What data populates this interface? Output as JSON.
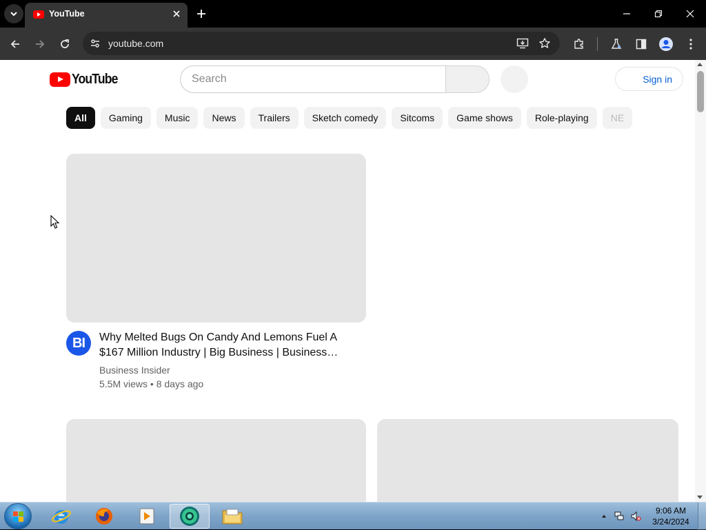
{
  "browser": {
    "tab": {
      "title": "YouTube",
      "favicon": "youtube-favicon-icon"
    },
    "url": "youtube.com",
    "toolbar_icons": [
      "back-icon",
      "forward-icon",
      "reload-icon",
      "site-info-icon",
      "install-app-icon",
      "bookmark-star-icon",
      "extensions-icon",
      "labs-icon",
      "side-panel-icon",
      "profile-icon",
      "menu-icon"
    ]
  },
  "youtube": {
    "logo_text": "YouTube",
    "search": {
      "placeholder": "Search",
      "value": ""
    },
    "signin_label": "Sign in",
    "chips": [
      {
        "label": "All",
        "active": true
      },
      {
        "label": "Gaming"
      },
      {
        "label": "Music"
      },
      {
        "label": "News"
      },
      {
        "label": "Trailers"
      },
      {
        "label": "Sketch comedy"
      },
      {
        "label": "Sitcoms"
      },
      {
        "label": "Game shows"
      },
      {
        "label": "Role-playing"
      },
      {
        "label": "NE"
      }
    ],
    "videos": [
      {
        "title": "Why Melted Bugs On Candy And Lemons Fuel A $167 Million Industry | Big Business | Business…",
        "channel": "Business Insider",
        "channel_initials": "BI",
        "views": "5.5M views",
        "age": "8 days ago",
        "meta": "5.5M views • 8 days ago"
      }
    ]
  },
  "taskbar": {
    "apps": [
      "internet-explorer-icon",
      "firefox-icon",
      "media-player-icon",
      "chrome-canary-icon",
      "file-explorer-icon"
    ],
    "clock": {
      "time": "9:06 AM",
      "date": "3/24/2024"
    }
  },
  "colors": {
    "youtube_red": "#ff0000",
    "signin_blue": "#065fd4",
    "avatar_blue": "#1a56e8"
  }
}
